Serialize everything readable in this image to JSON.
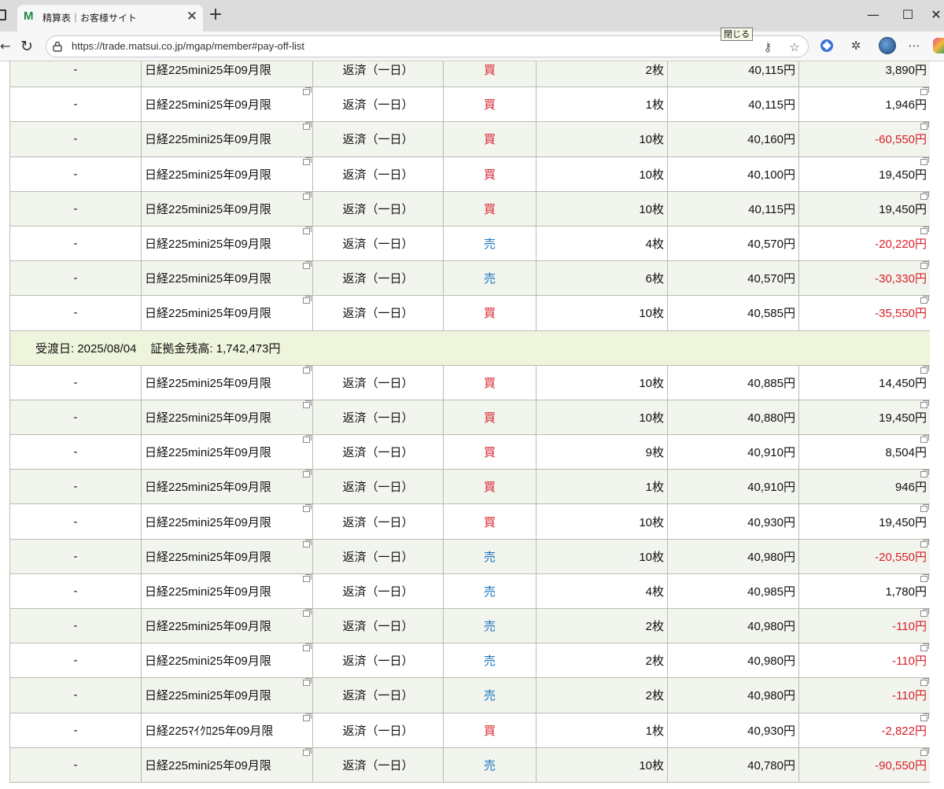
{
  "browser": {
    "tab_title": "精算表｜お客様サイト",
    "favicon_letter": "M",
    "url": "https://trade.matsui.co.jp/mgap/member#pay-off-list",
    "tooltip": "閉じる"
  },
  "table": {
    "rows_top": [
      {
        "id": "-",
        "name": "日経225mini25年09月限",
        "type": "返済（一日）",
        "side": "買",
        "side_kind": "buy",
        "qty": "2枚",
        "price": "40,115円",
        "pl": "3,890円",
        "pl_kind": "pos"
      },
      {
        "id": "-",
        "name": "日経225mini25年09月限",
        "type": "返済（一日）",
        "side": "買",
        "side_kind": "buy",
        "qty": "1枚",
        "price": "40,115円",
        "pl": "1,946円",
        "pl_kind": "pos"
      },
      {
        "id": "-",
        "name": "日経225mini25年09月限",
        "type": "返済（一日）",
        "side": "買",
        "side_kind": "buy",
        "qty": "10枚",
        "price": "40,160円",
        "pl": "-60,550円",
        "pl_kind": "neg"
      },
      {
        "id": "-",
        "name": "日経225mini25年09月限",
        "type": "返済（一日）",
        "side": "買",
        "side_kind": "buy",
        "qty": "10枚",
        "price": "40,100円",
        "pl": "19,450円",
        "pl_kind": "pos"
      },
      {
        "id": "-",
        "name": "日経225mini25年09月限",
        "type": "返済（一日）",
        "side": "買",
        "side_kind": "buy",
        "qty": "10枚",
        "price": "40,115円",
        "pl": "19,450円",
        "pl_kind": "pos"
      },
      {
        "id": "-",
        "name": "日経225mini25年09月限",
        "type": "返済（一日）",
        "side": "売",
        "side_kind": "sell",
        "qty": "4枚",
        "price": "40,570円",
        "pl": "-20,220円",
        "pl_kind": "neg"
      },
      {
        "id": "-",
        "name": "日経225mini25年09月限",
        "type": "返済（一日）",
        "side": "売",
        "side_kind": "sell",
        "qty": "6枚",
        "price": "40,570円",
        "pl": "-30,330円",
        "pl_kind": "neg"
      },
      {
        "id": "-",
        "name": "日経225mini25年09月限",
        "type": "返済（一日）",
        "side": "買",
        "side_kind": "buy",
        "qty": "10枚",
        "price": "40,585円",
        "pl": "-35,550円",
        "pl_kind": "neg"
      }
    ],
    "date_row": {
      "delivery": "受渡日: 2025/08/04",
      "margin": "証拠金残高: 1,742,473円"
    },
    "rows_bottom": [
      {
        "id": "-",
        "name": "日経225mini25年09月限",
        "type": "返済（一日）",
        "side": "買",
        "side_kind": "buy",
        "qty": "10枚",
        "price": "40,885円",
        "pl": "14,450円",
        "pl_kind": "pos"
      },
      {
        "id": "-",
        "name": "日経225mini25年09月限",
        "type": "返済（一日）",
        "side": "買",
        "side_kind": "buy",
        "qty": "10枚",
        "price": "40,880円",
        "pl": "19,450円",
        "pl_kind": "pos"
      },
      {
        "id": "-",
        "name": "日経225mini25年09月限",
        "type": "返済（一日）",
        "side": "買",
        "side_kind": "buy",
        "qty": "9枚",
        "price": "40,910円",
        "pl": "8,504円",
        "pl_kind": "pos"
      },
      {
        "id": "-",
        "name": "日経225mini25年09月限",
        "type": "返済（一日）",
        "side": "買",
        "side_kind": "buy",
        "qty": "1枚",
        "price": "40,910円",
        "pl": "946円",
        "pl_kind": "pos"
      },
      {
        "id": "-",
        "name": "日経225mini25年09月限",
        "type": "返済（一日）",
        "side": "買",
        "side_kind": "buy",
        "qty": "10枚",
        "price": "40,930円",
        "pl": "19,450円",
        "pl_kind": "pos"
      },
      {
        "id": "-",
        "name": "日経225mini25年09月限",
        "type": "返済（一日）",
        "side": "売",
        "side_kind": "sell",
        "qty": "10枚",
        "price": "40,980円",
        "pl": "-20,550円",
        "pl_kind": "neg"
      },
      {
        "id": "-",
        "name": "日経225mini25年09月限",
        "type": "返済（一日）",
        "side": "売",
        "side_kind": "sell",
        "qty": "4枚",
        "price": "40,985円",
        "pl": "1,780円",
        "pl_kind": "pos"
      },
      {
        "id": "-",
        "name": "日経225mini25年09月限",
        "type": "返済（一日）",
        "side": "売",
        "side_kind": "sell",
        "qty": "2枚",
        "price": "40,980円",
        "pl": "-110円",
        "pl_kind": "neg"
      },
      {
        "id": "-",
        "name": "日経225mini25年09月限",
        "type": "返済（一日）",
        "side": "売",
        "side_kind": "sell",
        "qty": "2枚",
        "price": "40,980円",
        "pl": "-110円",
        "pl_kind": "neg"
      },
      {
        "id": "-",
        "name": "日経225mini25年09月限",
        "type": "返済（一日）",
        "side": "売",
        "side_kind": "sell",
        "qty": "2枚",
        "price": "40,980円",
        "pl": "-110円",
        "pl_kind": "neg"
      },
      {
        "id": "-",
        "name": "日経225ﾏｲｸﾛ25年09月限",
        "type": "返済（一日）",
        "side": "買",
        "side_kind": "buy",
        "qty": "1枚",
        "price": "40,930円",
        "pl": "-2,822円",
        "pl_kind": "neg"
      },
      {
        "id": "-",
        "name": "日経225mini25年09月限",
        "type": "返済（一日）",
        "side": "売",
        "side_kind": "sell",
        "qty": "10枚",
        "price": "40,780円",
        "pl": "-90,550円",
        "pl_kind": "neg"
      }
    ]
  },
  "colors": {
    "buy": "#d8202a",
    "sell": "#1a74c0",
    "negative": "#d8202a",
    "row_alt": "#f2f5ee",
    "date_row_bg": "#eef5dc"
  }
}
